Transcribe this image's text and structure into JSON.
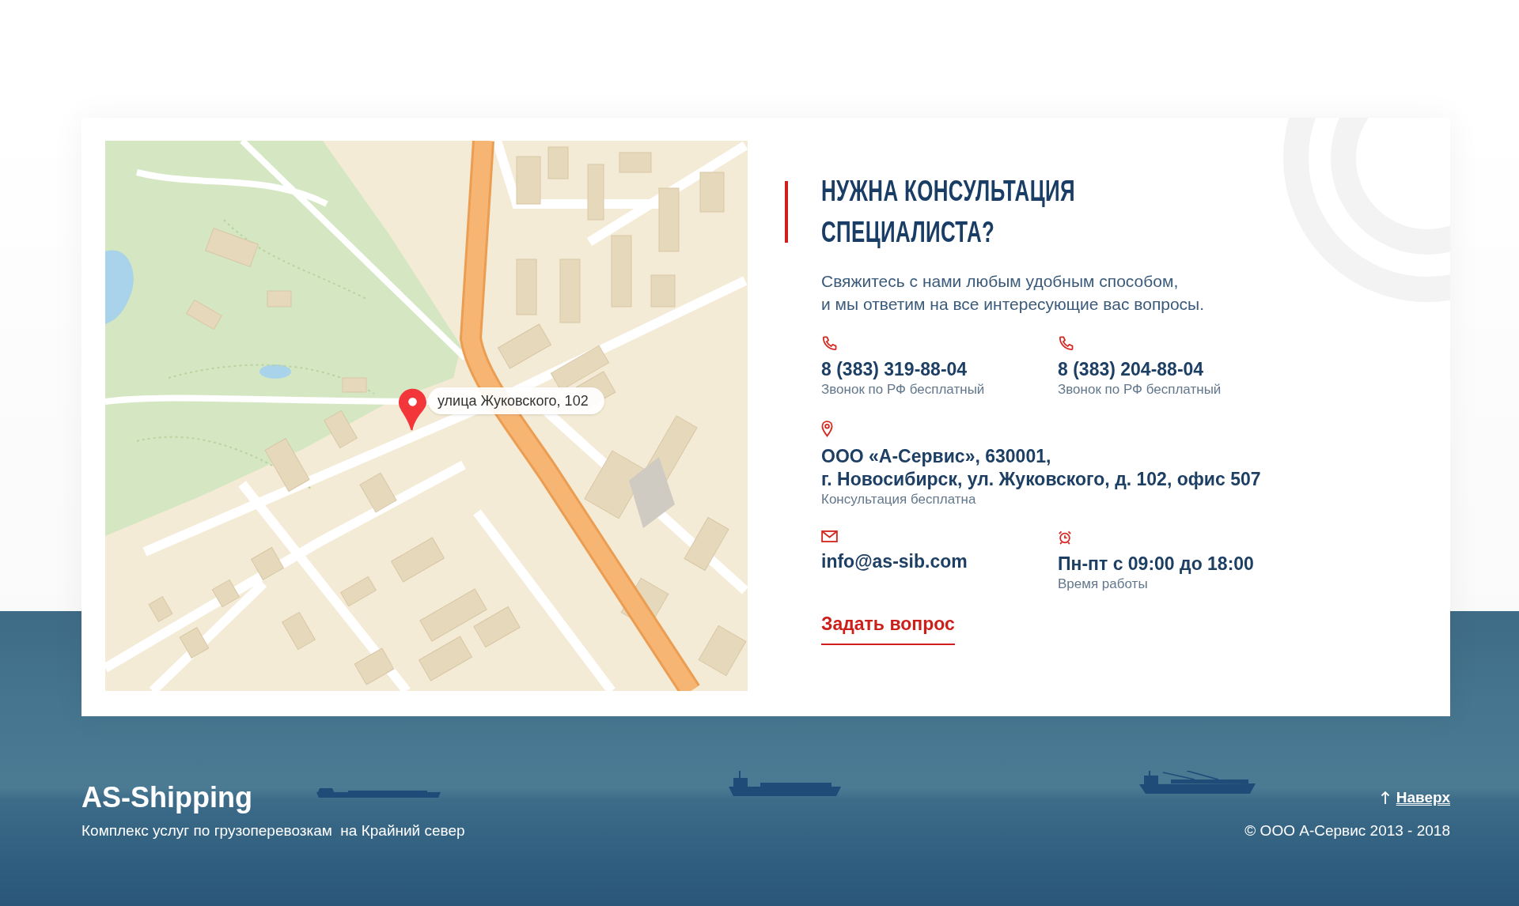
{
  "map": {
    "marker_label": "улица Жуковского, 102"
  },
  "contact": {
    "heading": "НУЖНА КОНСУЛЬТАЦИЯ СПЕЦИАЛИСТА?",
    "intro_lines": [
      "Свяжитесь с нами любым удобным способом,",
      "и мы ответим на все интересующие вас вопросы."
    ],
    "items": [
      {
        "kind": "phone",
        "lines": [
          "8 (383) 319-88-04"
        ],
        "note": "Звонок по РФ бесплатный"
      },
      {
        "kind": "phone",
        "lines": [
          "8 (383) 204-88-04"
        ],
        "note": "Звонок по РФ бесплатный"
      },
      {
        "kind": "address",
        "lines": [
          "ООО «А-Сервис», 630001,",
          "г. Новосибирск, ул. Жуковского, д. 102, офис 507"
        ],
        "note": "Консультация бесплатна"
      },
      {
        "kind": "email",
        "lines": [
          "info@as-sib.com"
        ]
      },
      {
        "kind": "hours",
        "lines": [
          "Пн-пт с 09:00 до 18:00"
        ],
        "note": "Время работы"
      }
    ],
    "button": "Задать вопрос"
  },
  "footer": {
    "brand": "AS-Shipping",
    "tagline": "Комплекс услуг по грузоперевозкам  на Крайний север",
    "back_to_top": "Наверх",
    "copyright": "© ООО А-Сервис 2013 - 2018"
  }
}
